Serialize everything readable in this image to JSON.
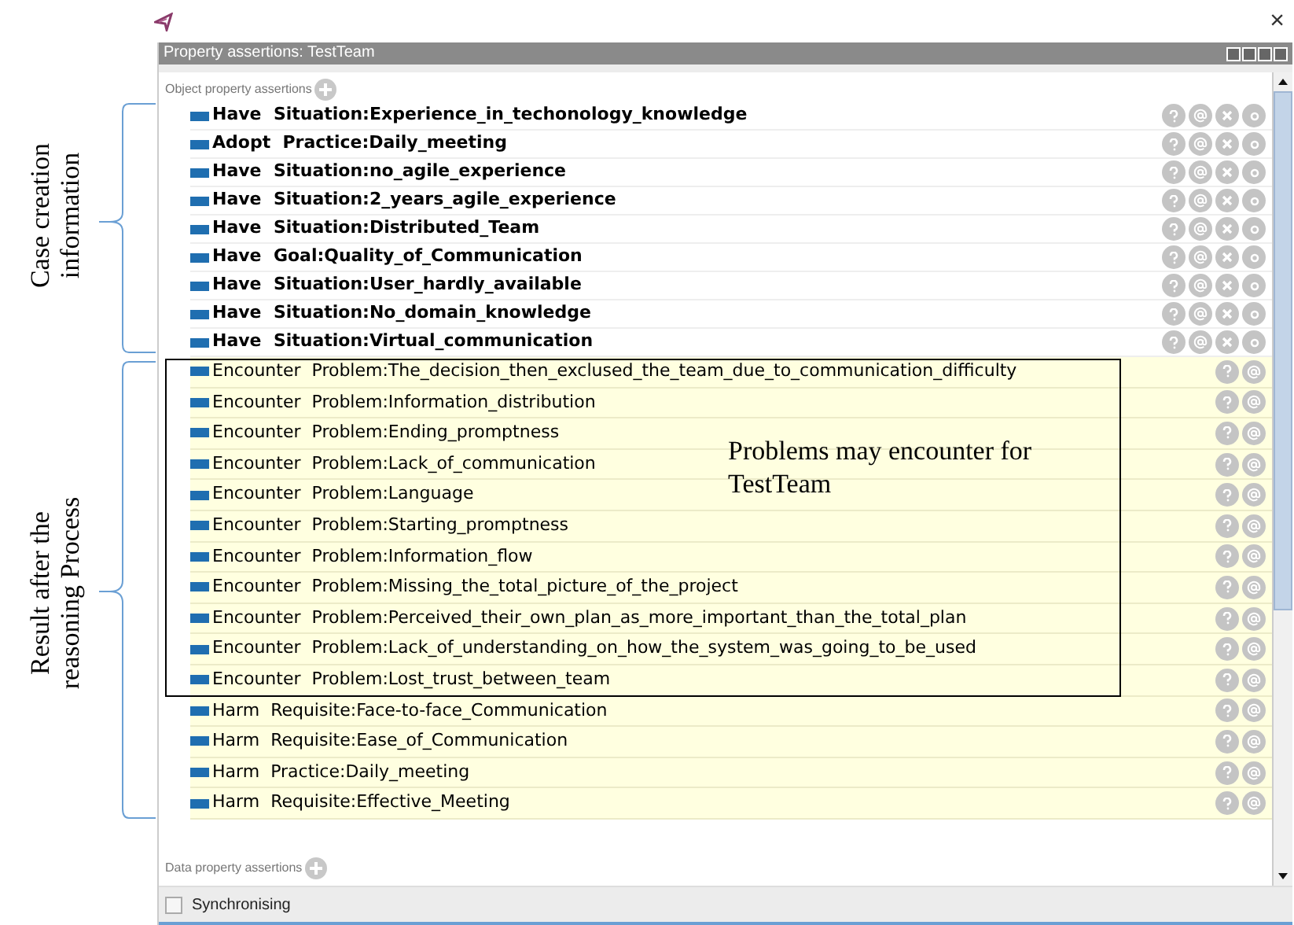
{
  "window": {
    "close": "×"
  },
  "panel": {
    "title": "Property assertions: TestTeam"
  },
  "object_section": {
    "label": "Object property assertions"
  },
  "assertions": [
    {
      "kind": "asserted",
      "verb": "Have",
      "value": "Situation:Experience_in_techonology_knowledge"
    },
    {
      "kind": "asserted",
      "verb": "Adopt",
      "value": "Practice:Daily_meeting"
    },
    {
      "kind": "asserted",
      "verb": "Have",
      "value": "Situation:no_agile_experience"
    },
    {
      "kind": "asserted",
      "verb": "Have",
      "value": "Situation:2_years_agile_experience"
    },
    {
      "kind": "asserted",
      "verb": "Have",
      "value": "Situation:Distributed_Team"
    },
    {
      "kind": "asserted",
      "verb": "Have",
      "value": "Goal:Quality_of_Communication"
    },
    {
      "kind": "asserted",
      "verb": "Have",
      "value": "Situation:User_hardly_available"
    },
    {
      "kind": "asserted",
      "verb": "Have",
      "value": "Situation:No_domain_knowledge"
    },
    {
      "kind": "asserted",
      "verb": "Have",
      "value": "Situation:Virtual_communication"
    },
    {
      "kind": "inferred",
      "verb": "Encounter",
      "value": "Problem:The_decision_then_exclused_the_team_due_to_communication_difficulty"
    },
    {
      "kind": "inferred",
      "verb": "Encounter",
      "value": "Problem:Information_distribution"
    },
    {
      "kind": "inferred",
      "verb": "Encounter",
      "value": "Problem:Ending_promptness"
    },
    {
      "kind": "inferred",
      "verb": "Encounter",
      "value": "Problem:Lack_of_communication"
    },
    {
      "kind": "inferred",
      "verb": "Encounter",
      "value": "Problem:Language"
    },
    {
      "kind": "inferred",
      "verb": "Encounter",
      "value": "Problem:Starting_promptness"
    },
    {
      "kind": "inferred",
      "verb": "Encounter",
      "value": "Problem:Information_flow"
    },
    {
      "kind": "inferred",
      "verb": "Encounter",
      "value": "Problem:Missing_the_total_picture_of_the_project"
    },
    {
      "kind": "inferred",
      "verb": "Encounter",
      "value": "Problem:Perceived_their_own_plan_as_more_important_than_the_total_plan"
    },
    {
      "kind": "inferred",
      "verb": "Encounter",
      "value": "Problem:Lack_of_understanding_on_how_the_system_was_going_to_be_used"
    },
    {
      "kind": "inferred",
      "verb": "Encounter",
      "value": "Problem:Lost_trust_between_team"
    },
    {
      "kind": "inferred",
      "verb": "Harm",
      "value": "Requisite:Face-to-face_Communication"
    },
    {
      "kind": "inferred",
      "verb": "Harm",
      "value": "Requisite:Ease_of_Communication"
    },
    {
      "kind": "inferred",
      "verb": "Harm",
      "value": "Practice:Daily_meeting"
    },
    {
      "kind": "inferred",
      "verb": "Harm",
      "value": "Requisite:Effective_Meeting"
    }
  ],
  "data_section": {
    "label": "Data property assertions"
  },
  "synchronising": {
    "label": "Synchronising",
    "checked": false
  },
  "annotations": {
    "case_label": "Case creation information",
    "result_label": "Result after the reasoning Process",
    "problems_note": "Problems may encounter for TestTeam"
  }
}
